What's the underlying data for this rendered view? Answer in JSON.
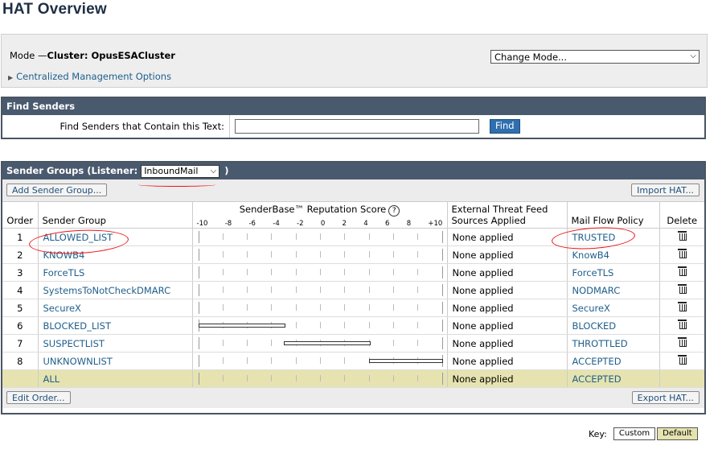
{
  "page": {
    "title": "HAT Overview"
  },
  "mode": {
    "label_prefix": "Mode —",
    "cluster_label": "Cluster: OpusESACluster",
    "select_value": "Change Mode...",
    "centralized_link": "Centralized Management Options"
  },
  "find": {
    "header": "Find Senders",
    "label": "Find Senders that Contain this Text:",
    "input_value": "",
    "button": "Find"
  },
  "sender_groups": {
    "header_prefix": "Sender Groups (Listener:",
    "header_suffix": ")",
    "listener_value": "InboundMail",
    "add_button": "Add Sender Group...",
    "import_button": "Import HAT...",
    "edit_order_button": "Edit Order...",
    "export_button": "Export HAT...",
    "columns": {
      "order": "Order",
      "group": "Sender Group",
      "score": "SenderBase™ Reputation Score",
      "ext_line1": "External Threat Feed",
      "ext_line2": "Sources Applied",
      "policy": "Mail Flow Policy",
      "delete": "Delete"
    },
    "score_ticks": [
      "-10",
      "-8",
      "-6",
      "-4",
      "-2",
      "0",
      "2",
      "4",
      "6",
      "8",
      "+10"
    ],
    "rows": [
      {
        "order": "1",
        "group": "ALLOWED_LIST",
        "ext": "None applied",
        "policy": "TRUSTED",
        "range": null
      },
      {
        "order": "2",
        "group": "KNOWB4",
        "ext": "None applied",
        "policy": "KnowB4",
        "range": null
      },
      {
        "order": "3",
        "group": "ForceTLS",
        "ext": "None applied",
        "policy": "ForceTLS",
        "range": null
      },
      {
        "order": "4",
        "group": "SystemsToNotCheckDMARC",
        "ext": "None applied",
        "policy": "NODMARC",
        "range": null
      },
      {
        "order": "5",
        "group": "SecureX",
        "ext": "None applied",
        "policy": "SecureX",
        "range": null
      },
      {
        "order": "6",
        "group": "BLOCKED_LIST",
        "ext": "None applied",
        "policy": "BLOCKED",
        "range": [
          -10,
          -3
        ]
      },
      {
        "order": "7",
        "group": "SUSPECTLIST",
        "ext": "None applied",
        "policy": "THROTTLED",
        "range": [
          -3,
          4
        ]
      },
      {
        "order": "8",
        "group": "UNKNOWNLIST",
        "ext": "None applied",
        "policy": "ACCEPTED",
        "range": [
          4,
          10
        ]
      }
    ],
    "all_row": {
      "group": "ALL",
      "ext": "None applied",
      "policy": "ACCEPTED"
    }
  },
  "key": {
    "label": "Key:",
    "custom": "Custom",
    "default": "Default"
  },
  "colors": {
    "header_bg": "#4a5a6e",
    "link": "#1f5f8b",
    "all_row_bg": "#e6e3b0",
    "annotation": "#e11111"
  }
}
